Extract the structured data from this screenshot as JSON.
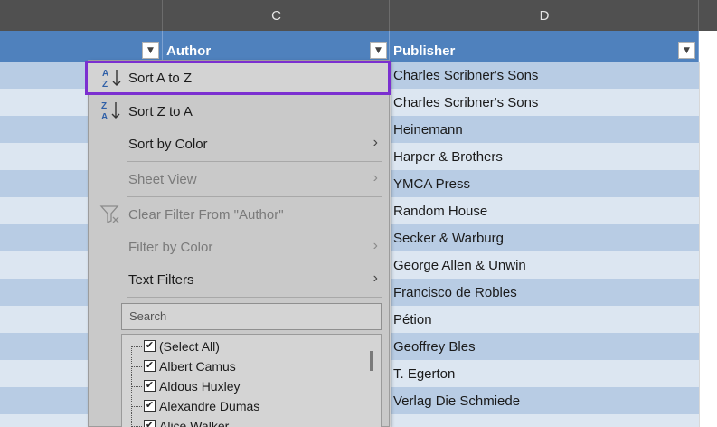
{
  "columns": {
    "c": "C",
    "d": "D"
  },
  "table_header": {
    "author": "Author",
    "publisher": "Publisher",
    "filter_glyph": "▼"
  },
  "publishers": [
    "Charles Scribner's Sons",
    "Charles Scribner's Sons",
    "Heinemann",
    "Harper & Brothers",
    "YMCA Press",
    "Random House",
    "Secker & Warburg",
    "George Allen & Unwin",
    "Francisco de Robles",
    "Pétion",
    "Geoffrey Bles",
    "T. Egerton",
    "Verlag Die Schmiede",
    ""
  ],
  "menu": {
    "sort_az": "Sort A to Z",
    "sort_za": "Sort Z to A",
    "sort_by_color": "Sort by Color",
    "sheet_view": "Sheet View",
    "clear_filter": "Clear Filter From \"Author\"",
    "filter_by_color": "Filter by Color",
    "text_filters": "Text Filters",
    "chevron": "›",
    "search_placeholder": "Search",
    "list": [
      "(Select All)",
      "Albert Camus",
      "Aldous Huxley",
      "Alexandre Dumas",
      "Alice Walker"
    ],
    "check": "✔"
  },
  "colors": {
    "accent_highlight": "#7b2fd0",
    "header_blue": "#4f81bd",
    "band_dark": "#b8cce4",
    "band_light": "#dce6f1"
  }
}
